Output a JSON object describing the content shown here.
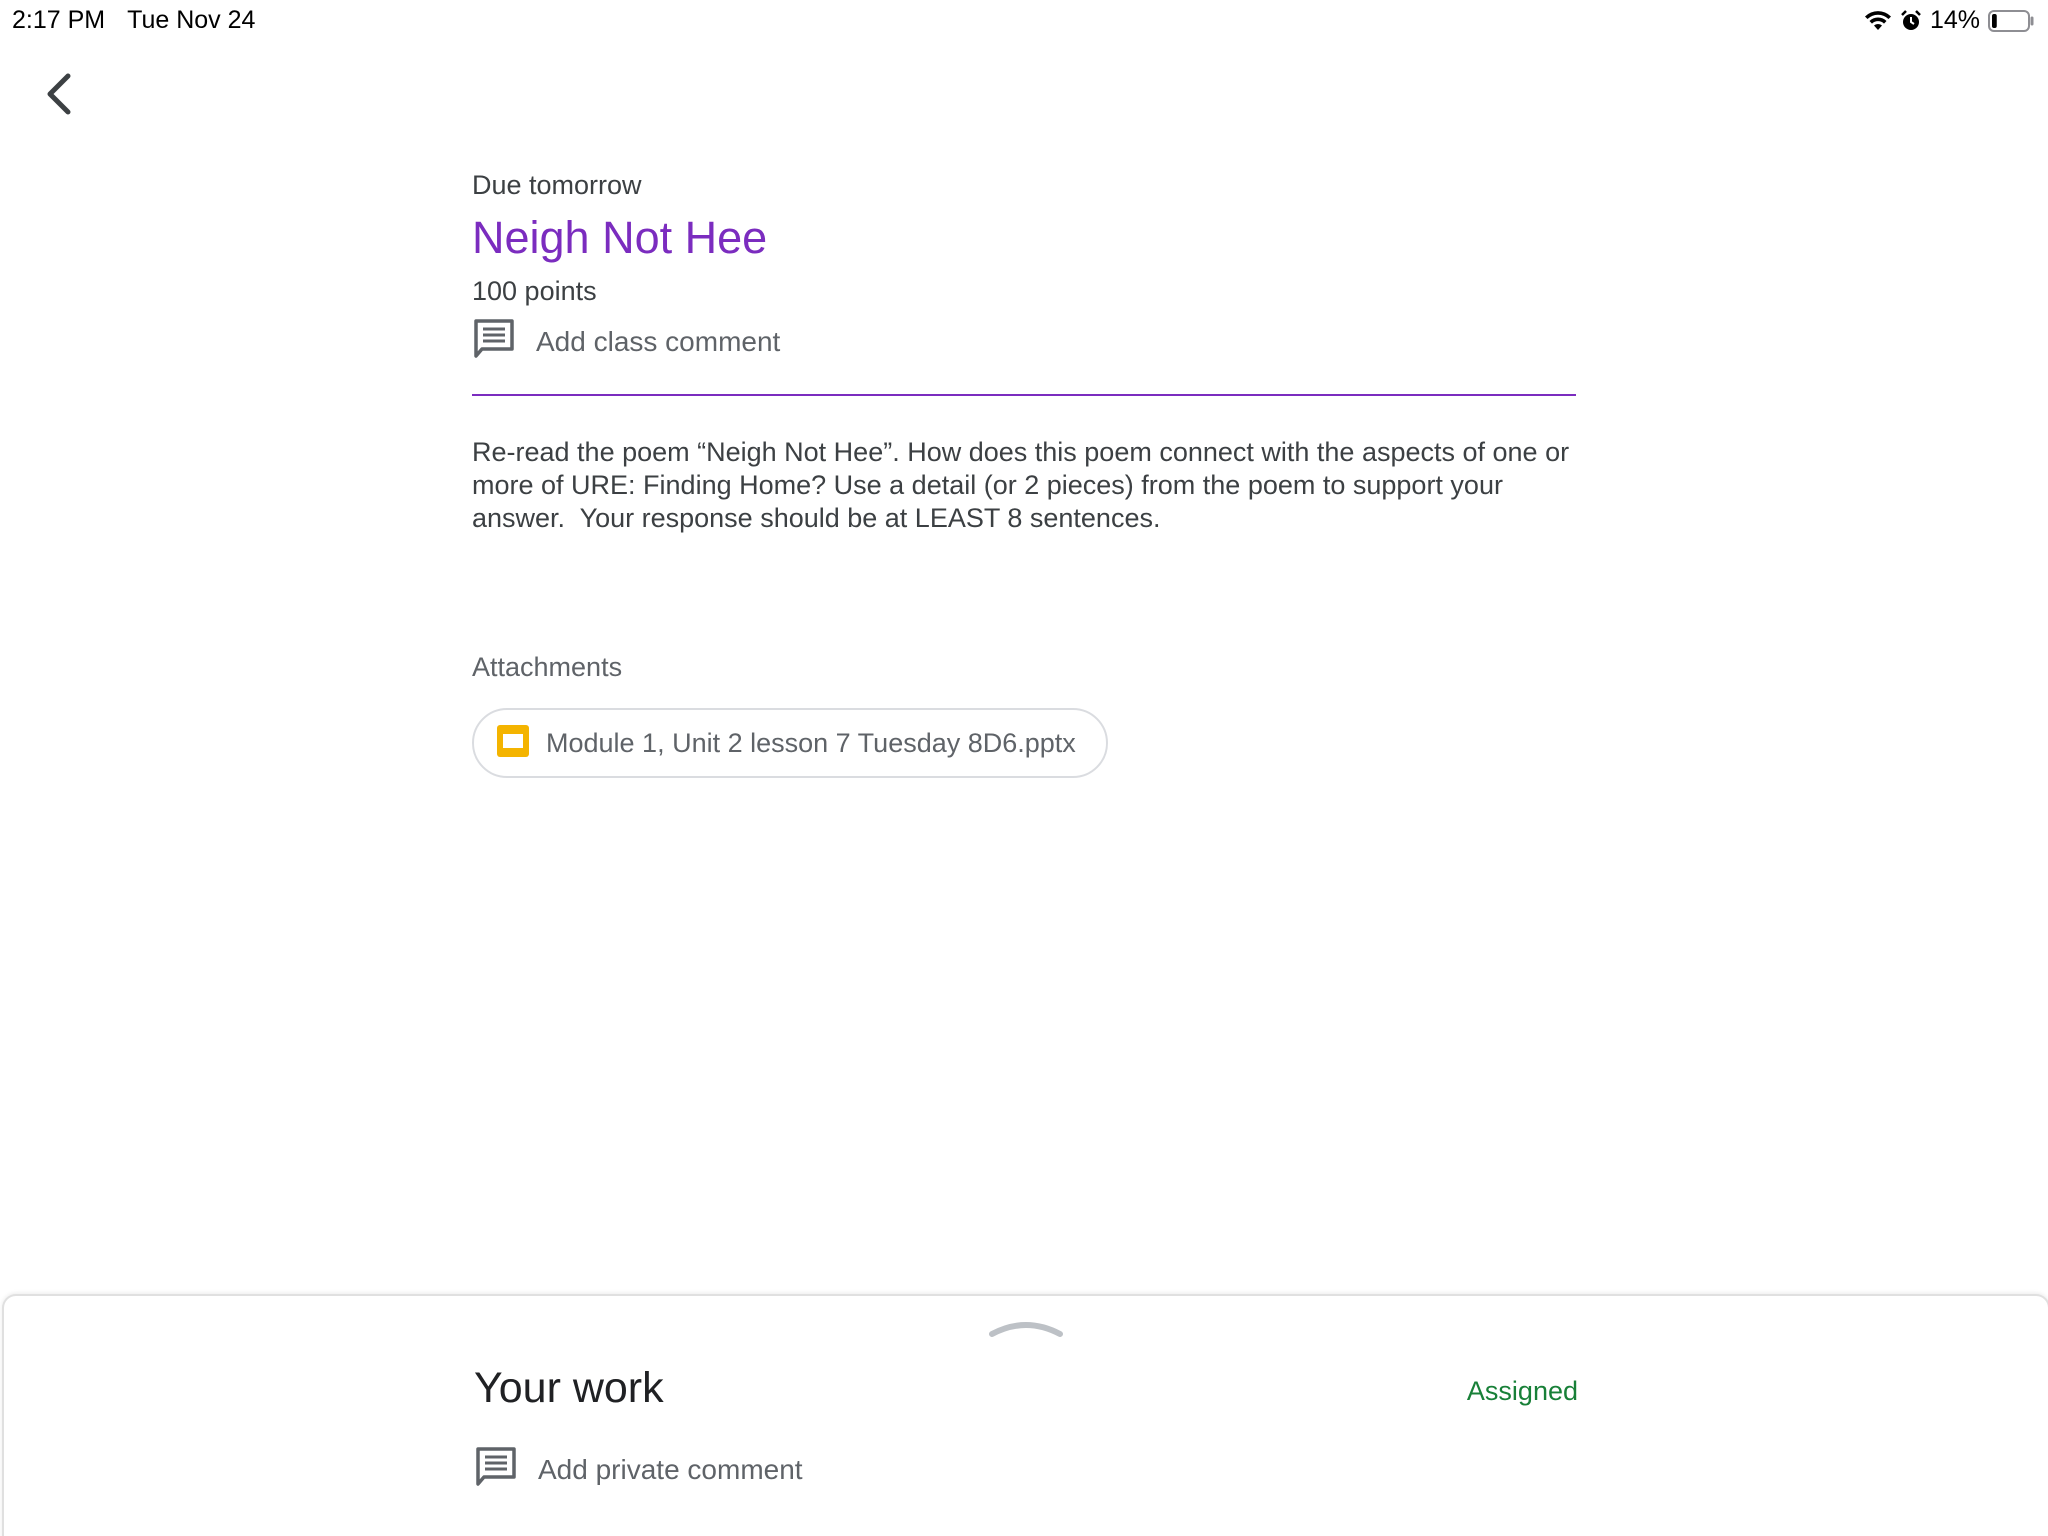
{
  "status_bar": {
    "time": "2:17 PM",
    "date": "Tue Nov 24",
    "battery_percent": "14%",
    "battery_level": 0.14,
    "icons": [
      "wifi-icon",
      "alarm-icon",
      "battery-icon"
    ]
  },
  "nav": {
    "back_icon": "chevron-left-icon"
  },
  "assignment": {
    "due": "Due tomorrow",
    "title": "Neigh Not Hee",
    "points": "100 points",
    "class_comment_label": "Add class comment",
    "instructions": "Re-read the poem “Neigh Not Hee”. How does this poem connect with the aspects of one or more of URE: Finding Home? Use a detail (or 2 pieces) from the poem to support your answer.  Your response should be at LEAST 8 sentences."
  },
  "attachments": {
    "label": "Attachments",
    "items": [
      {
        "name": "Module 1, Unit 2 lesson 7 Tuesday 8D6.pptx",
        "icon": "slides-icon"
      }
    ]
  },
  "your_work": {
    "title": "Your work",
    "status": "Assigned",
    "private_comment_label": "Add private comment"
  },
  "colors": {
    "accent": "#7b2cbf",
    "assigned": "#188038",
    "slides_icon": "#f4b400"
  }
}
